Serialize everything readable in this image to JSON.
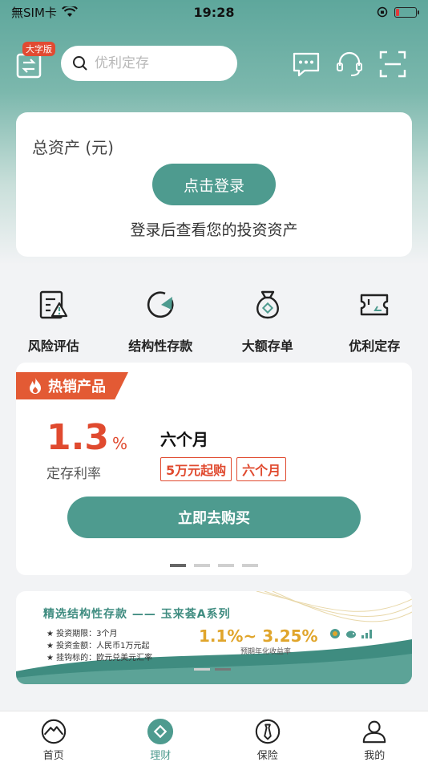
{
  "status_bar": {
    "carrier": "無SIM卡",
    "time": "19:28"
  },
  "header": {
    "big_font_badge": "大字版",
    "search_placeholder": "优利定存"
  },
  "asset_card": {
    "title": "总资产 (元)",
    "login_label": "点击登录",
    "hint": "登录后查看您的投资资产"
  },
  "quick_nav": [
    {
      "label": "风险评估",
      "icon": "risk-assessment-icon"
    },
    {
      "label": "结构性存款",
      "icon": "structured-deposit-icon"
    },
    {
      "label": "大额存单",
      "icon": "money-bag-icon"
    },
    {
      "label": "优利定存",
      "icon": "ticket-icon"
    }
  ],
  "hot_product": {
    "tag": "热销产品",
    "rate": "1.3",
    "rate_unit": "%",
    "rate_label": "定存利率",
    "term": "六个月",
    "chips": [
      "5万元起购",
      "六个月"
    ],
    "buy_label": "立即去购买",
    "carousel_active_index": 0,
    "carousel_count": 4
  },
  "banner": {
    "title": "精选结构性存款 —— 玉来荟A系列",
    "items": [
      "★ 投资期限：3个月",
      "★ 投资金额：人民币1万元起",
      "★ 挂钩标的：欧元兑美元汇率"
    ],
    "rate": "1.1%~ 3.25%",
    "rate_label": "预期年化收益率"
  },
  "tabs": [
    {
      "label": "首页",
      "icon": "home-mountain-icon"
    },
    {
      "label": "理财",
      "icon": "wealth-icon",
      "active": true
    },
    {
      "label": "保险",
      "icon": "insurance-tie-icon"
    },
    {
      "label": "我的",
      "icon": "profile-icon"
    }
  ],
  "colors": {
    "primary": "#4e9b8f",
    "accent_red": "#e04a2f",
    "banner_gold": "#e0a52b"
  }
}
